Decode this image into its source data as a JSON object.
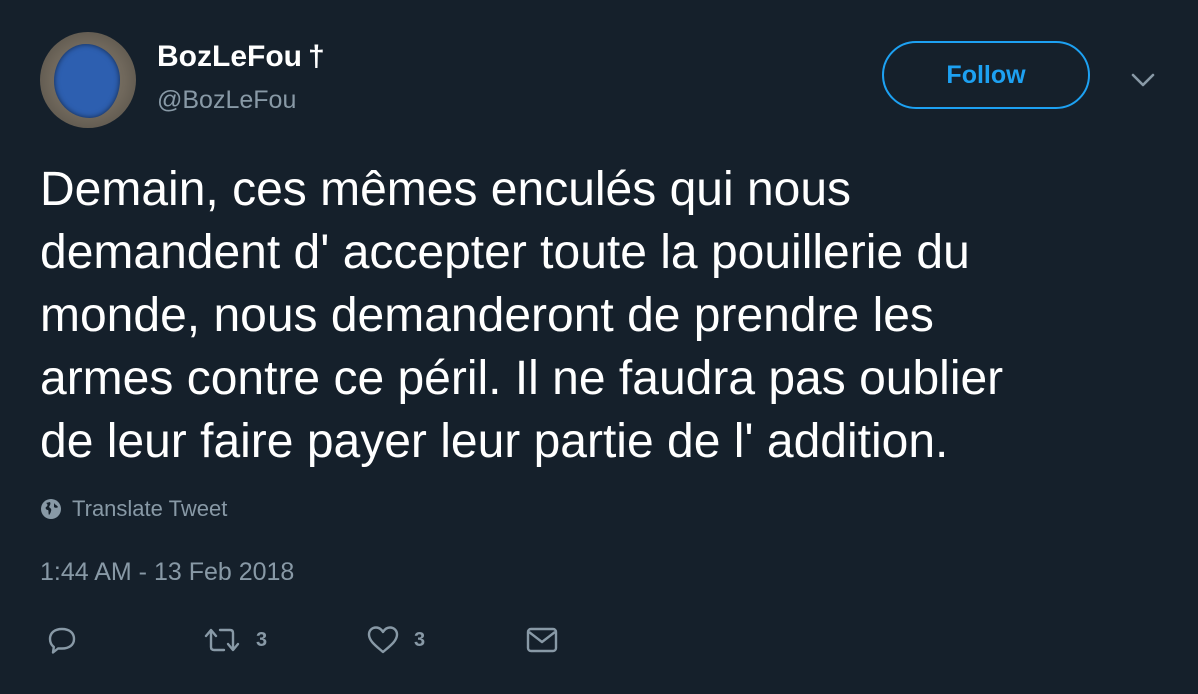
{
  "user": {
    "display_name": "BozLeFou",
    "name_suffix_symbol": "†",
    "handle": "@BozLeFou"
  },
  "header": {
    "follow_label": "Follow",
    "menu_icon": "chevron-down-icon"
  },
  "tweet": {
    "text": "Demain, ces mêmes enculés qui nous\ndemandent d' accepter toute la pouillerie du\nmonde, nous demanderont de prendre les\narmes contre ce péril. Il ne faudra pas oublier\nde leur faire payer leur partie de l' addition.",
    "translate_label": "Translate Tweet",
    "timestamp": "1:44 AM - 13 Feb 2018"
  },
  "actions": {
    "reply_icon": "reply-icon",
    "retweet_icon": "retweet-icon",
    "retweet_count": "3",
    "like_icon": "heart-icon",
    "like_count": "3",
    "dm_icon": "envelope-icon"
  },
  "colors": {
    "background": "#15202b",
    "accent": "#1da1f2",
    "secondary_text": "#8899a6",
    "primary_text": "#ffffff"
  }
}
